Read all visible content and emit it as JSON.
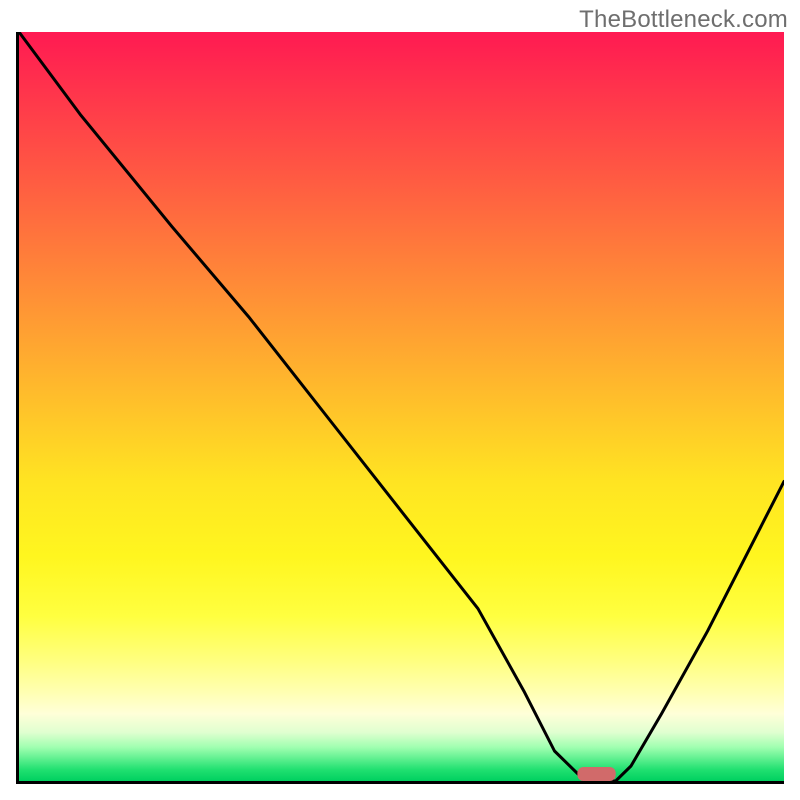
{
  "watermark": "TheBottleneck.com",
  "chart_data": {
    "type": "line",
    "title": "",
    "xlabel": "",
    "ylabel": "",
    "xlim": [
      0,
      100
    ],
    "ylim": [
      0,
      100
    ],
    "series": [
      {
        "name": "bottleneck-curve",
        "x": [
          0,
          8,
          20,
          30,
          40,
          50,
          60,
          66,
          70,
          74,
          78,
          80,
          84,
          90,
          100
        ],
        "y": [
          100,
          89,
          74,
          62,
          49,
          36,
          23,
          12,
          4,
          0,
          0,
          2,
          9,
          20,
          40
        ]
      }
    ],
    "marker": {
      "name": "optimal-range",
      "x_start": 73,
      "x_end": 78,
      "y": 0
    },
    "background_gradient": {
      "stops": [
        {
          "pct": 0,
          "color": "#ff1a52"
        },
        {
          "pct": 50,
          "color": "#ffc22a"
        },
        {
          "pct": 78,
          "color": "#ffff40"
        },
        {
          "pct": 100,
          "color": "#00d060"
        }
      ]
    }
  }
}
